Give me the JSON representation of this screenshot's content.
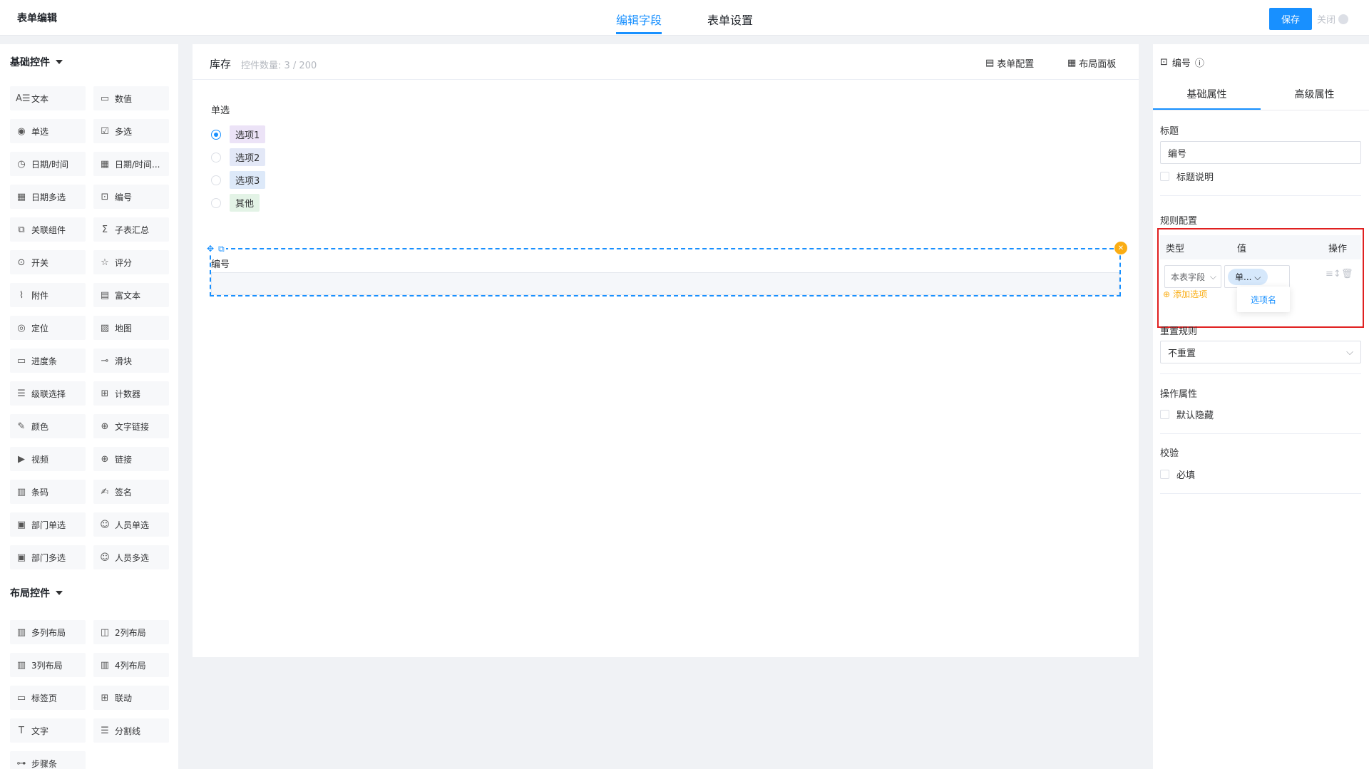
{
  "topbar": {
    "title": "表单编辑",
    "tabs": [
      "编辑字段",
      "表单设置"
    ],
    "save": "保存",
    "close": "关闭"
  },
  "left": {
    "group1": "基础控件",
    "group2": "布局控件",
    "basic": [
      {
        "icon": "text-icon",
        "glyph": "A☰",
        "label": "文本"
      },
      {
        "icon": "number-icon",
        "glyph": "▭",
        "label": "数值"
      },
      {
        "icon": "radio-icon",
        "glyph": "◉",
        "label": "单选"
      },
      {
        "icon": "checkbox-icon",
        "glyph": "☑",
        "label": "多选"
      },
      {
        "icon": "clock-icon",
        "glyph": "◷",
        "label": "日期/时间"
      },
      {
        "icon": "calendar-icon",
        "glyph": "▦",
        "label": "日期/时间..."
      },
      {
        "icon": "calendar-multi-icon",
        "glyph": "▦",
        "label": "日期多选"
      },
      {
        "icon": "serial-icon",
        "glyph": "⊡",
        "label": "编号"
      },
      {
        "icon": "link-component-icon",
        "glyph": "⧉",
        "label": "关联组件"
      },
      {
        "icon": "sigma-icon",
        "glyph": "Σ",
        "label": "子表汇总"
      },
      {
        "icon": "switch-icon",
        "glyph": "⊙",
        "label": "开关"
      },
      {
        "icon": "star-icon",
        "glyph": "☆",
        "label": "评分"
      },
      {
        "icon": "paperclip-icon",
        "glyph": "⌇",
        "label": "附件"
      },
      {
        "icon": "richtext-icon",
        "glyph": "▤",
        "label": "富文本"
      },
      {
        "icon": "location-icon",
        "glyph": "◎",
        "label": "定位"
      },
      {
        "icon": "map-icon",
        "glyph": "▨",
        "label": "地图"
      },
      {
        "icon": "progress-icon",
        "glyph": "▭",
        "label": "进度条"
      },
      {
        "icon": "slider-icon",
        "glyph": "⊸",
        "label": "滑块"
      },
      {
        "icon": "cascade-icon",
        "glyph": "☰",
        "label": "级联选择"
      },
      {
        "icon": "counter-icon",
        "glyph": "⊞",
        "label": "计数器"
      },
      {
        "icon": "color-icon",
        "glyph": "✎",
        "label": "颜色"
      },
      {
        "icon": "globe-icon",
        "glyph": "⊕",
        "label": "文字链接"
      },
      {
        "icon": "video-icon",
        "glyph": "▶",
        "label": "视频"
      },
      {
        "icon": "link-icon",
        "glyph": "⊕",
        "label": "链接"
      },
      {
        "icon": "barcode-icon",
        "glyph": "▥",
        "label": "条码"
      },
      {
        "icon": "signature-icon",
        "glyph": "✍",
        "label": "签名"
      },
      {
        "icon": "dept-icon",
        "glyph": "▣",
        "label": "部门单选"
      },
      {
        "icon": "user-icon",
        "glyph": "☺",
        "label": "人员单选"
      },
      {
        "icon": "dept-multi-icon",
        "glyph": "▣",
        "label": "部门多选"
      },
      {
        "icon": "users-icon",
        "glyph": "☺",
        "label": "人员多选"
      }
    ],
    "layout": [
      {
        "icon": "columns-icon",
        "glyph": "▥",
        "label": "多列布局"
      },
      {
        "icon": "two-col-icon",
        "glyph": "◫",
        "label": "2列布局"
      },
      {
        "icon": "three-col-icon",
        "glyph": "▥",
        "label": "3列布局"
      },
      {
        "icon": "four-col-icon",
        "glyph": "▥",
        "label": "4列布局"
      },
      {
        "icon": "tabs-icon",
        "glyph": "▭",
        "label": "标签页"
      },
      {
        "icon": "linkage-icon",
        "glyph": "⊞",
        "label": "联动"
      },
      {
        "icon": "text-t-icon",
        "glyph": "T",
        "label": "文字"
      },
      {
        "icon": "divider-icon",
        "glyph": "☰",
        "label": "分割线"
      },
      {
        "icon": "steps-icon",
        "glyph": "⊶",
        "label": "步骤条"
      }
    ]
  },
  "canvas": {
    "name": "库存",
    "count": "控件数量: 3 / 200",
    "form_config": "表单配置",
    "layout_panel": "布局面板",
    "radio_label": "单选",
    "options": [
      {
        "label": "选项1",
        "bg": "#ece3f7",
        "checked": true
      },
      {
        "label": "选项2",
        "bg": "#e3e8f7",
        "checked": false
      },
      {
        "label": "选项3",
        "bg": "#dde9f9",
        "checked": false
      },
      {
        "label": "其他",
        "bg": "#e3f3e6",
        "checked": false
      }
    ],
    "serial_label": "编号"
  },
  "right": {
    "field_name": "编号",
    "tabs": [
      "基础属性",
      "高级属性"
    ],
    "title_label": "标题",
    "title_value": "编号",
    "title_desc": "标题说明",
    "rule_config": "规则配置",
    "rule_cols": [
      "类型",
      "值",
      "操作"
    ],
    "rule_type": "本表字段",
    "rule_value": "单...",
    "add_option": "添加选项",
    "dropdown_option": "选项名",
    "reset_label": "重置规则",
    "reset_value": "不重置",
    "op_attr": "操作属性",
    "default_hidden": "默认隐藏",
    "validation": "校验",
    "required": "必填"
  },
  "colors": {
    "accent": "#1890ff",
    "warning": "#faad14",
    "highlight": "#e02020"
  }
}
